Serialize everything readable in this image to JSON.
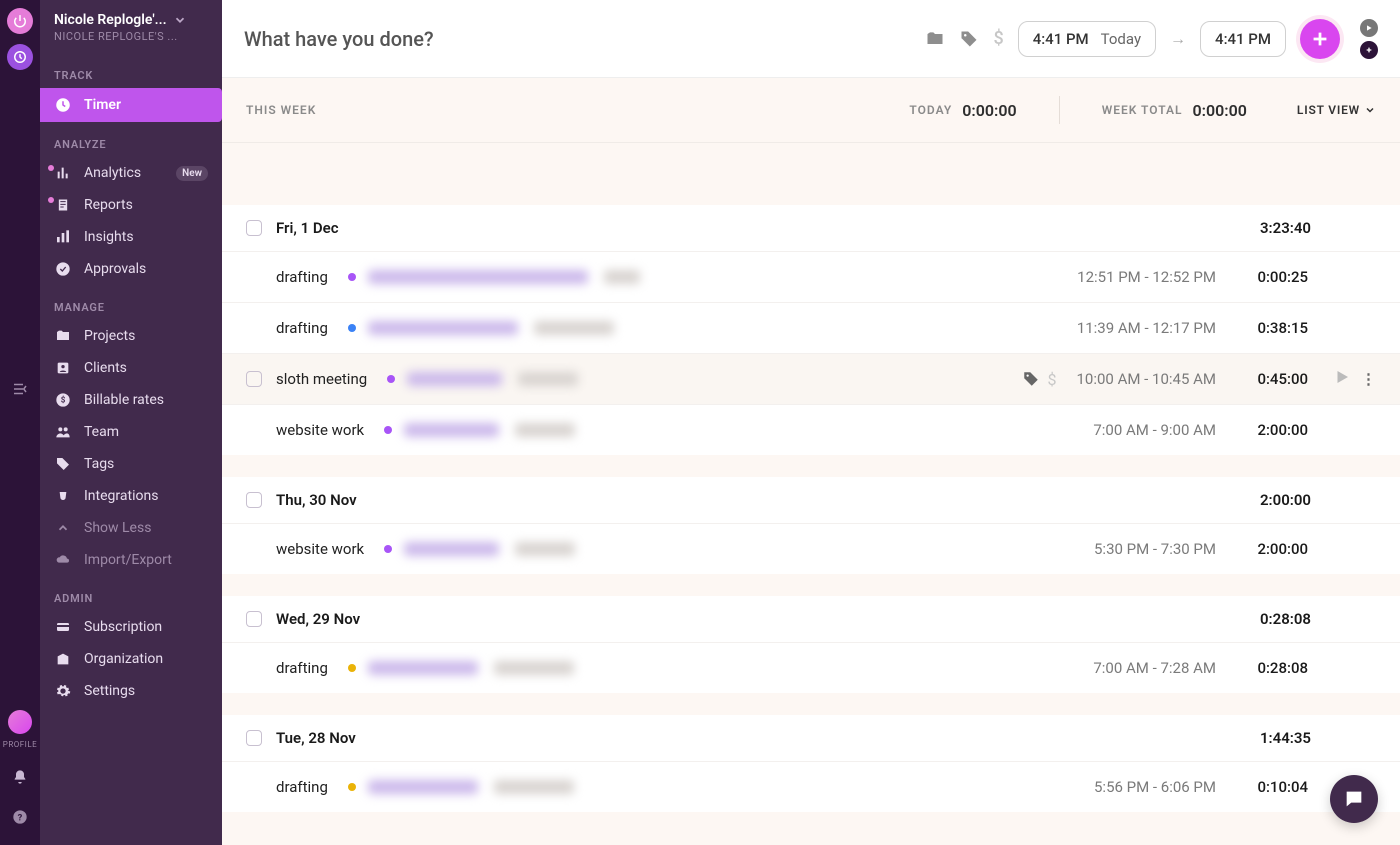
{
  "workspace": {
    "name": "Nicole Replogle'...",
    "sub": "NICOLE REPLOGLE'S ..."
  },
  "rail": {
    "profile_label": "PROFILE"
  },
  "sidebar": {
    "track_label": "TRACK",
    "analyze_label": "ANALYZE",
    "manage_label": "MANAGE",
    "admin_label": "ADMIN",
    "timer": "Timer",
    "analytics": "Analytics",
    "analytics_badge": "New",
    "reports": "Reports",
    "insights": "Insights",
    "approvals": "Approvals",
    "projects": "Projects",
    "clients": "Clients",
    "billable": "Billable rates",
    "team": "Team",
    "tags": "Tags",
    "integrations": "Integrations",
    "show_less": "Show Less",
    "import_export": "Import/Export",
    "subscription": "Subscription",
    "organization": "Organization",
    "settings": "Settings"
  },
  "topbar": {
    "placeholder": "What have you done?",
    "start_time": "4:41 PM",
    "start_date": "Today",
    "end_time": "4:41 PM"
  },
  "summary": {
    "this_week": "THIS WEEK",
    "today_label": "TODAY",
    "today_val": "0:00:00",
    "week_label": "WEEK TOTAL",
    "week_val": "0:00:00",
    "view_label": "LIST VIEW"
  },
  "days": [
    {
      "date": "Fri, 1 Dec",
      "total": "3:23:40",
      "entries": [
        {
          "desc": "drafting",
          "dot": "#a855f7",
          "b1w": 220,
          "b2w": 36,
          "range": "12:51 PM - 12:52 PM",
          "dur": "0:00:25"
        },
        {
          "desc": "drafting",
          "dot": "#3b82f6",
          "b1w": 150,
          "b2w": 80,
          "range": "11:39 AM - 12:17 PM",
          "dur": "0:38:15"
        },
        {
          "desc": "sloth meeting",
          "dot": "#a855f7",
          "b1w": 95,
          "b2w": 60,
          "range": "10:00 AM - 10:45 AM",
          "dur": "0:45:00",
          "hover": true
        },
        {
          "desc": "website work",
          "dot": "#a855f7",
          "b1w": 95,
          "b2w": 60,
          "range": "7:00 AM - 9:00 AM",
          "dur": "2:00:00"
        }
      ]
    },
    {
      "date": "Thu, 30 Nov",
      "total": "2:00:00",
      "entries": [
        {
          "desc": "website work",
          "dot": "#a855f7",
          "b1w": 95,
          "b2w": 60,
          "range": "5:30 PM - 7:30 PM",
          "dur": "2:00:00"
        }
      ]
    },
    {
      "date": "Wed, 29 Nov",
      "total": "0:28:08",
      "entries": [
        {
          "desc": "drafting",
          "dot": "#eab308",
          "b1w": 110,
          "b2w": 80,
          "range": "7:00 AM - 7:28 AM",
          "dur": "0:28:08"
        }
      ]
    },
    {
      "date": "Tue, 28 Nov",
      "total": "1:44:35",
      "entries": [
        {
          "desc": "drafting",
          "dot": "#eab308",
          "b1w": 110,
          "b2w": 80,
          "range": "5:56 PM - 6:06 PM",
          "dur": "0:10:04"
        }
      ]
    }
  ]
}
